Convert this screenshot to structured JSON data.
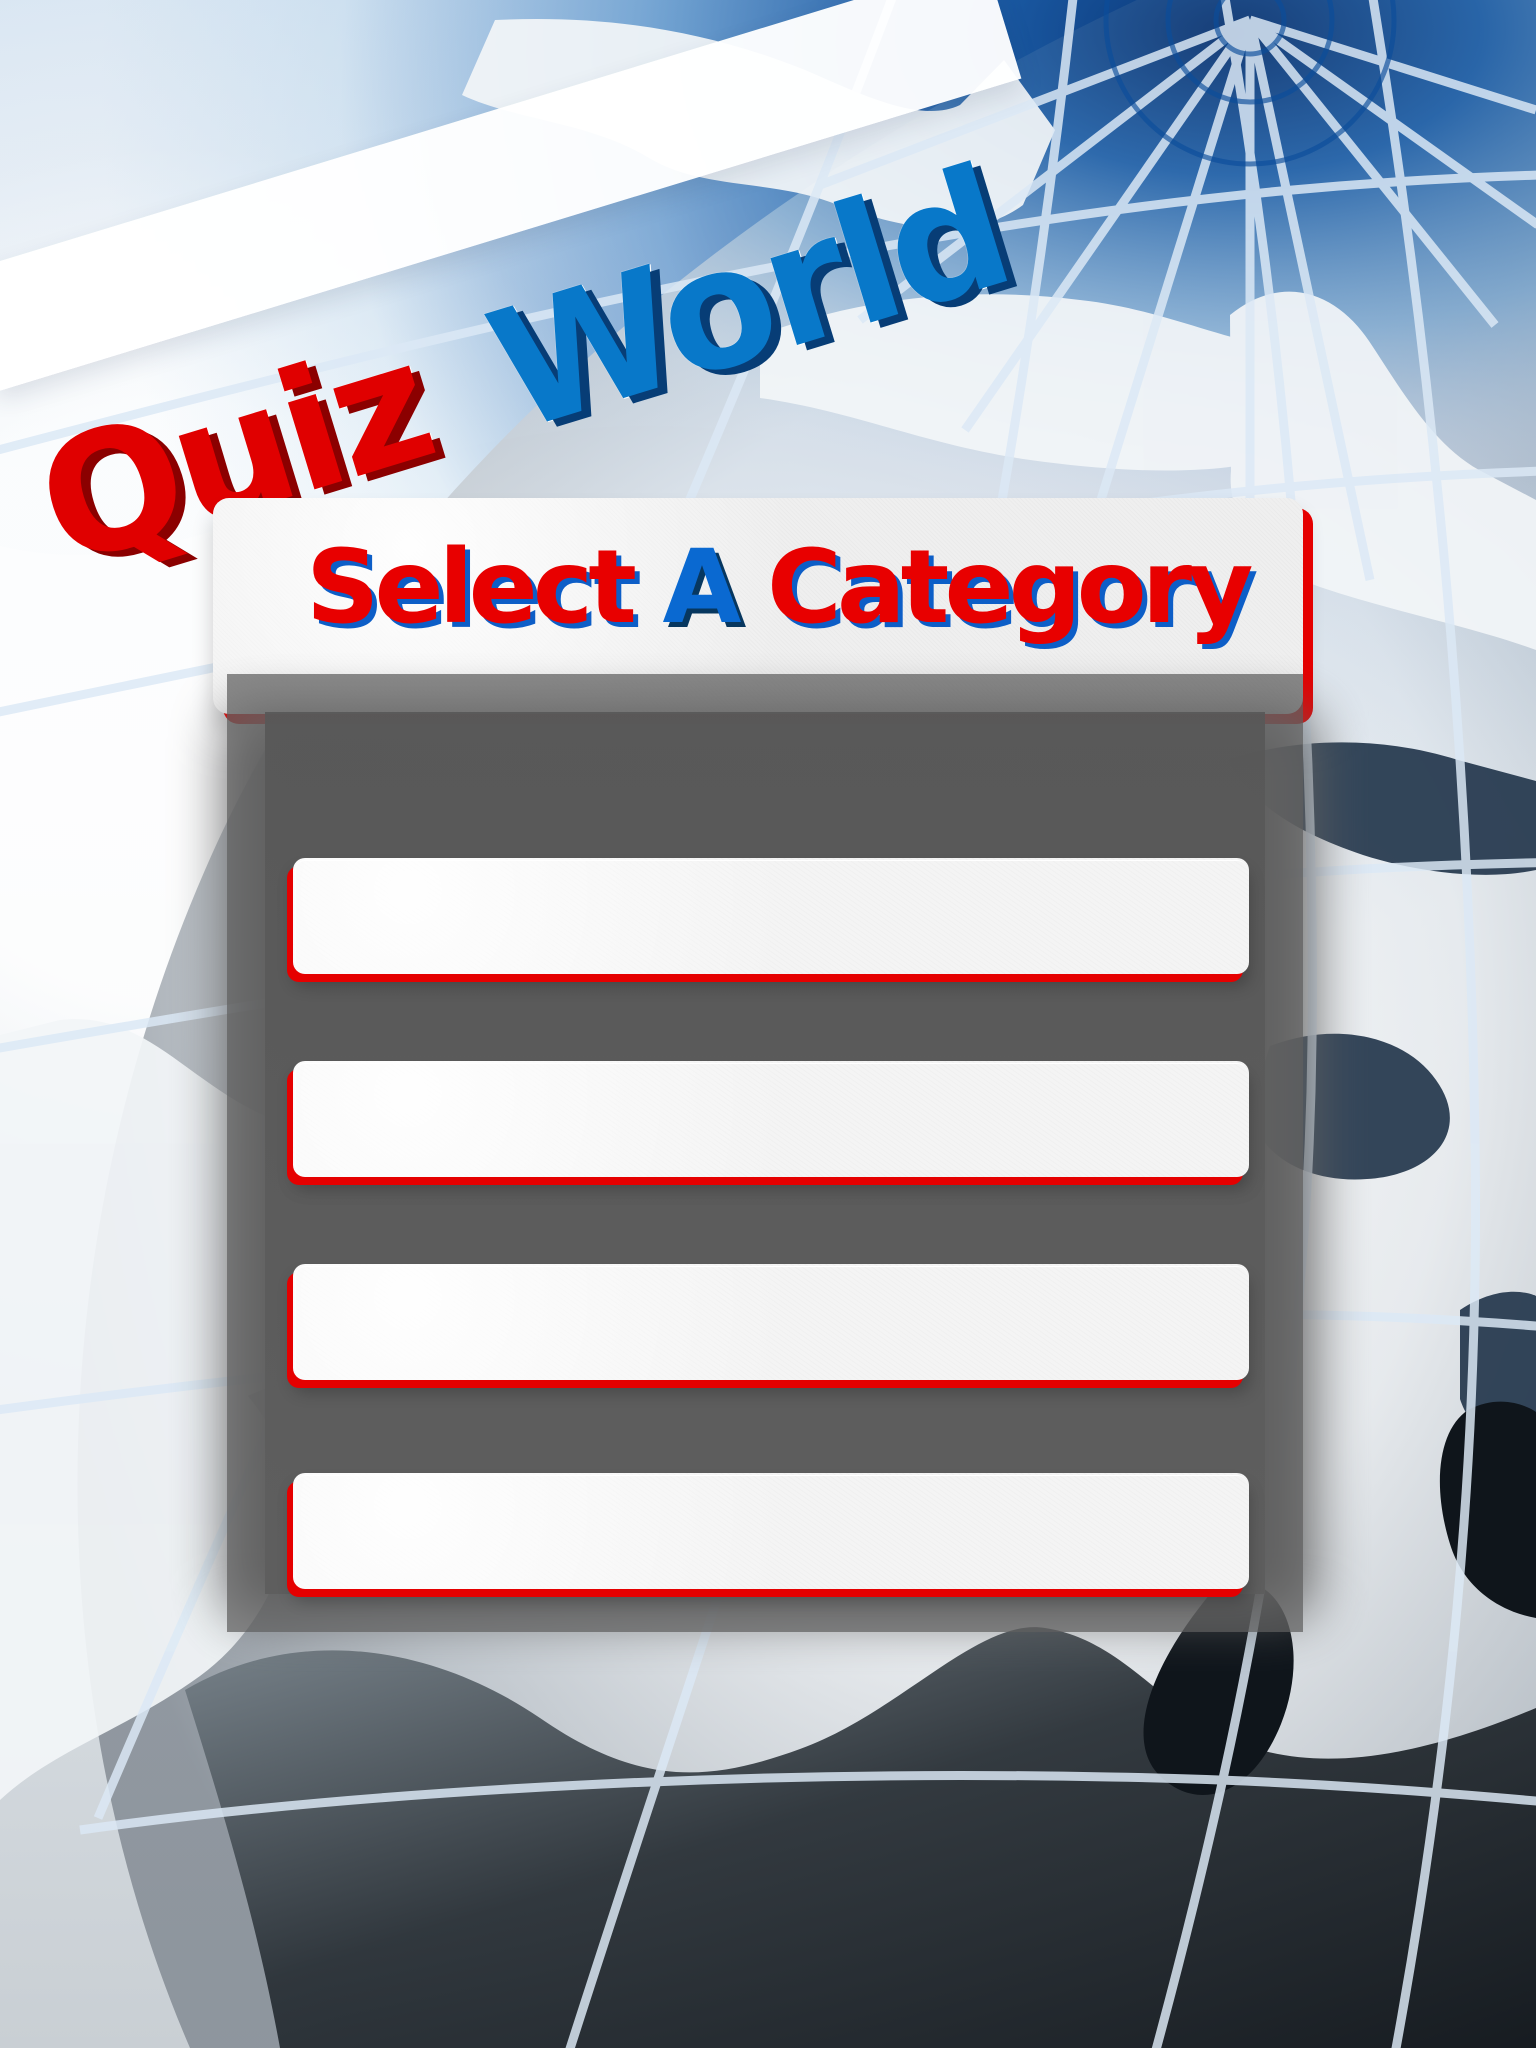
{
  "app": {
    "logo": {
      "quiz": "Quiz",
      "world": "World"
    },
    "header": {
      "select": "Select",
      "a": "A",
      "category": "Category"
    },
    "category_buttons": [
      {
        "label": ""
      },
      {
        "label": ""
      },
      {
        "label": ""
      },
      {
        "label": ""
      }
    ],
    "colors": {
      "red": "#e50000",
      "blue": "#0a69d1",
      "panel_gray": "#5f5f5f",
      "button_white": "#f4f4f4"
    },
    "background_icon": "globe-icon"
  }
}
